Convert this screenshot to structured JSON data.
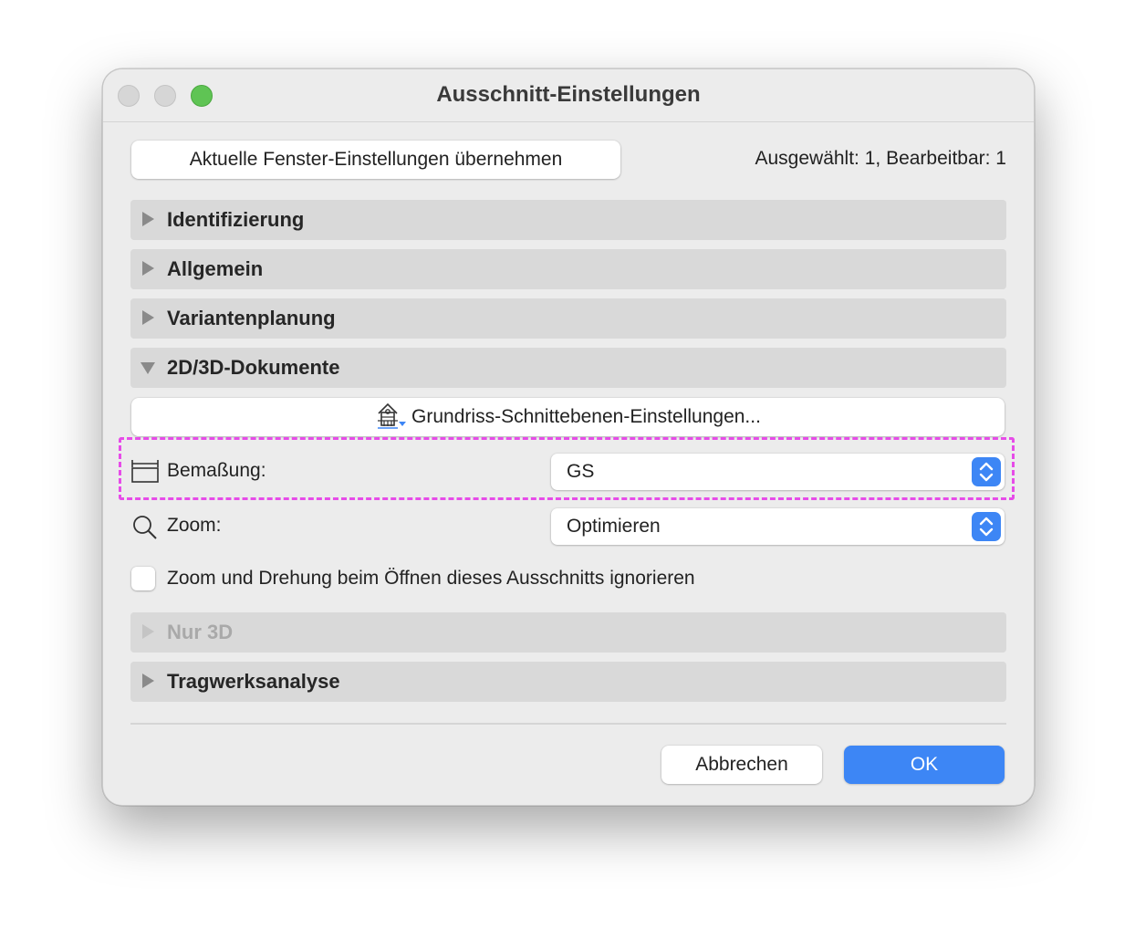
{
  "window": {
    "title": "Ausschnitt-Einstellungen"
  },
  "header": {
    "apply_button_label": "Aktuelle Fenster-Einstellungen übernehmen",
    "selection_info": "Ausgewählt: 1, Bearbeitbar: 1"
  },
  "sections": [
    {
      "label": "Identifizierung",
      "expanded": false,
      "enabled": true
    },
    {
      "label": "Allgemein",
      "expanded": false,
      "enabled": true
    },
    {
      "label": "Variantenplanung",
      "expanded": false,
      "enabled": true
    },
    {
      "label": "2D/3D-Dokumente",
      "expanded": true,
      "enabled": true
    },
    {
      "label": "Nur 3D",
      "expanded": false,
      "enabled": false
    },
    {
      "label": "Tragwerksanalyse",
      "expanded": false,
      "enabled": true
    }
  ],
  "docs": {
    "grundriss_button_label": "Grundriss-Schnittebenen-Einstellungen...",
    "grundriss_icon": "floor-plan-cut-plane-icon",
    "dimension": {
      "label": "Bemaßung:",
      "icon": "dimension-icon",
      "value": "GS"
    },
    "zoom": {
      "label": "Zoom:",
      "icon": "magnifier-icon",
      "value": "Optimieren"
    },
    "ignore_zoom": {
      "label": "Zoom und Drehung beim Öffnen dieses Ausschnitts ignorieren",
      "checked": false
    }
  },
  "footer": {
    "cancel_label": "Abbrechen",
    "ok_label": "OK"
  },
  "colors": {
    "accent": "#3d86f5",
    "highlight": "#e64ce8",
    "close_inactive": "#d6d6d6",
    "zoom_green": "#5fc454"
  }
}
